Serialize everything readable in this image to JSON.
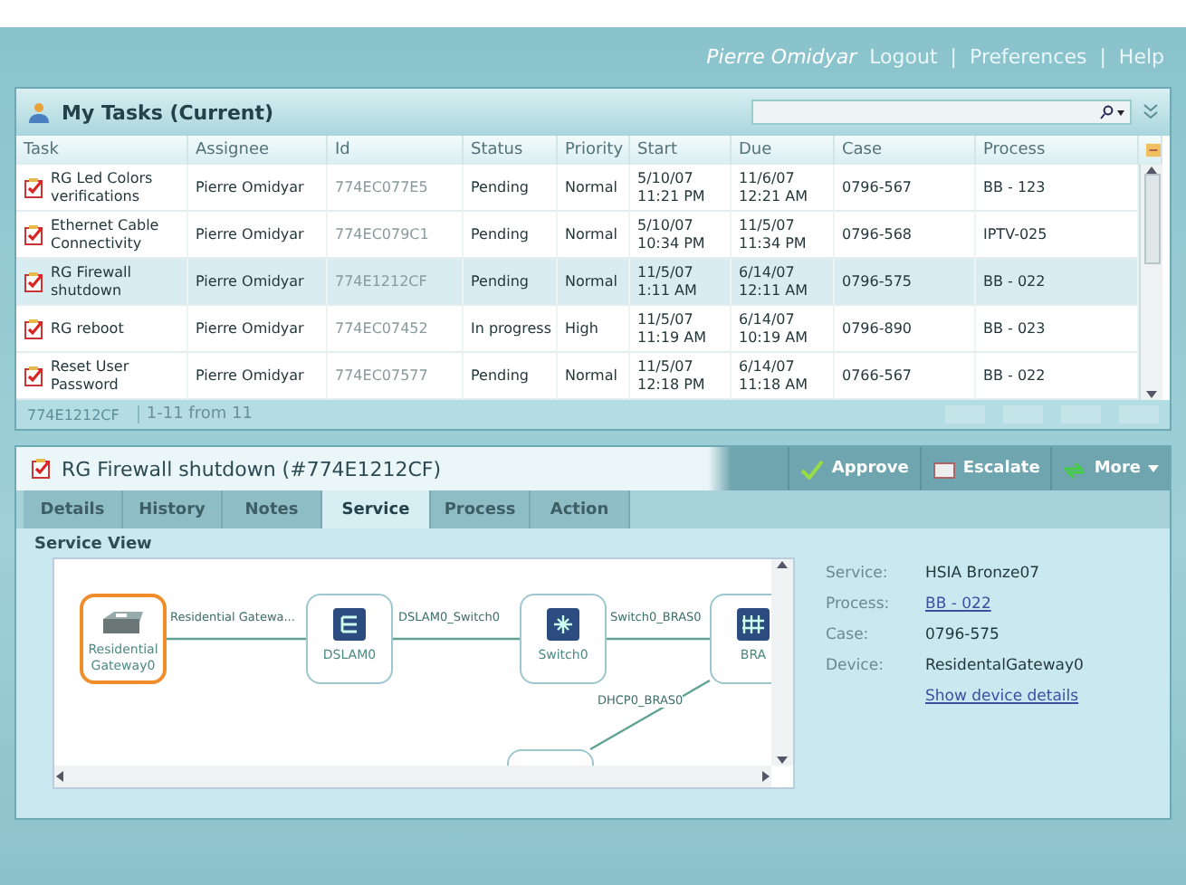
{
  "header": {
    "user": "Pierre Omidyar",
    "links": [
      "Logout",
      "Preferences",
      "Help"
    ],
    "separators": [
      "|",
      "|"
    ]
  },
  "tasks": {
    "title": "My Tasks (Current)",
    "columns": [
      "Task",
      "Assignee",
      "Id",
      "Status",
      "Priority",
      "Start",
      "Due",
      "Case",
      "Process"
    ],
    "rows": [
      {
        "selected": false,
        "cells": [
          "RG Led Colors verifications",
          "Pierre Omidyar",
          "774EC077E5",
          "Pending",
          "Normal",
          "5/10/07 11:21 PM",
          "11/6/07 12:21 AM",
          "0796-567",
          "BB - 123"
        ]
      },
      {
        "selected": false,
        "cells": [
          "Ethernet Cable Connectivity",
          "Pierre Omidyar",
          "774EC079C1",
          "Pending",
          "Normal",
          "5/10/07 10:34 PM",
          "11/5/07 11:34 PM",
          "0796-568",
          "IPTV-025"
        ]
      },
      {
        "selected": true,
        "cells": [
          "RG Firewall shutdown",
          "Pierre Omidyar",
          "774E1212CF",
          "Pending",
          "Normal",
          "11/5/07 1:11 AM",
          "6/14/07 12:11 AM",
          "0796-575",
          "BB - 022"
        ]
      },
      {
        "selected": false,
        "cells": [
          "RG reboot",
          "Pierre Omidyar",
          "774EC07452",
          "In progress",
          "High",
          "11/5/07 11:19 AM",
          "6/14/07 10:19 AM",
          "0796-890",
          "BB - 023"
        ]
      },
      {
        "selected": false,
        "cells": [
          "Reset User Password",
          "Pierre Omidyar",
          "774EC07577",
          "Pending",
          "Normal",
          "11/5/07 12:18 PM",
          "6/14/07 11:18 AM",
          "0766-567",
          "BB - 022"
        ]
      }
    ],
    "footer": {
      "selected_id": "774E1212CF",
      "count": "1-11 from 11"
    }
  },
  "detail": {
    "title": "RG Firewall shutdown (#774E1212CF)",
    "actions": [
      "Approve",
      "Escalate",
      "More"
    ],
    "tabs": [
      {
        "label": "Details",
        "selected": false
      },
      {
        "label": "History",
        "selected": false
      },
      {
        "label": "Notes",
        "selected": false
      },
      {
        "label": "Service",
        "selected": true
      },
      {
        "label": "Process",
        "selected": false
      },
      {
        "label": "Action",
        "selected": false
      }
    ],
    "section": "Service View",
    "nodes": [
      {
        "kind": "gateway",
        "label": "Residential Gateway0",
        "selected": true
      },
      {
        "kind": "dslam",
        "label": "DSLAM0",
        "selected": false
      },
      {
        "kind": "switch",
        "label": "Switch0",
        "selected": false
      },
      {
        "kind": "bras",
        "label": "BRA",
        "selected": false
      },
      {
        "kind": "server",
        "selected": false
      }
    ],
    "links": [
      "Residential Gatewa...",
      "DSLAM0_Switch0",
      "Switch0_BRAS0",
      "DHCP0_BRAS0"
    ],
    "info": [
      {
        "label": "Service:",
        "value": "HSIA Bronze07",
        "kind": "text"
      },
      {
        "label": "Process:",
        "value": "BB - 022",
        "kind": "link"
      },
      {
        "label": "Case:",
        "value": "0796-575",
        "kind": "text"
      },
      {
        "label": "Device:",
        "value": "ResidentalGateway0",
        "kind": "text"
      }
    ],
    "details_link": "Show device details"
  }
}
